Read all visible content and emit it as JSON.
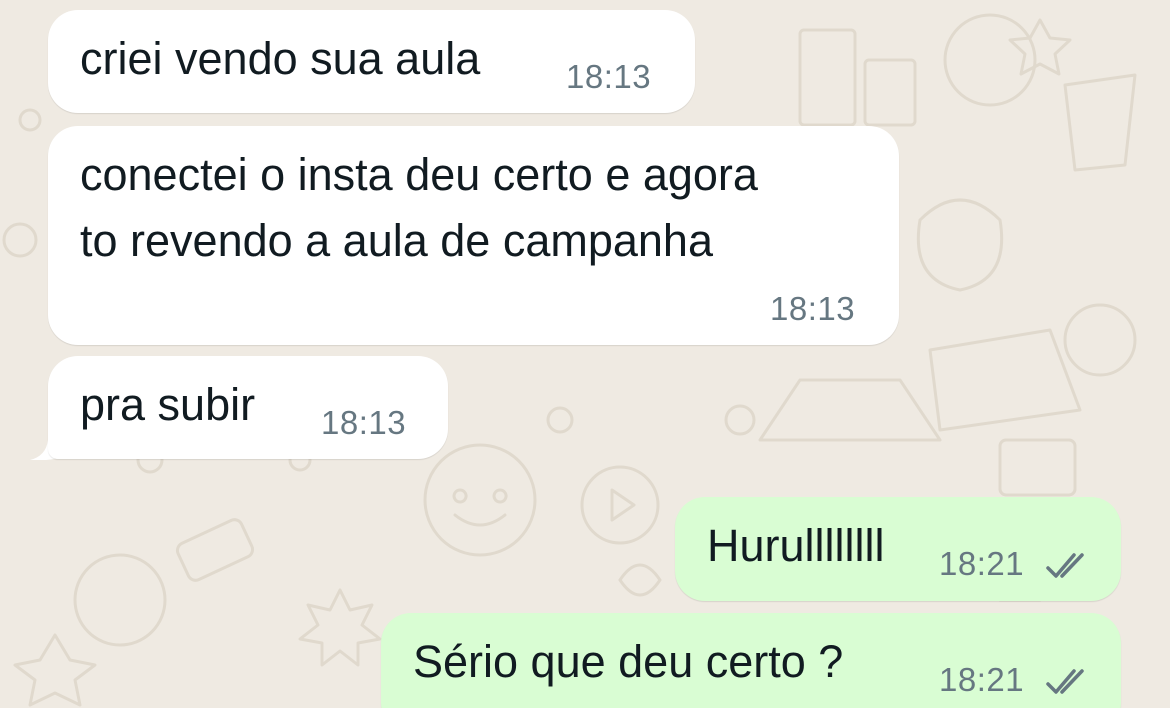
{
  "chat": {
    "messages": [
      {
        "direction": "incoming",
        "lines": [
          "criei vendo sua aula"
        ],
        "time": "18:13"
      },
      {
        "direction": "incoming",
        "lines": [
          "conectei o insta deu certo e agora",
          "to revendo a aula de campanha"
        ],
        "time": "18:13"
      },
      {
        "direction": "incoming",
        "lines": [
          "pra subir"
        ],
        "time": "18:13"
      },
      {
        "direction": "outgoing",
        "lines": [
          "Hurullllllll"
        ],
        "time": "18:21",
        "status": "read",
        "status_icon": "double-check-icon"
      },
      {
        "direction": "outgoing",
        "lines": [
          "Sério que deu certo ?"
        ],
        "time": "18:21",
        "status": "read",
        "status_icon": "double-check-icon"
      }
    ]
  },
  "theme": {
    "wallpaper": "#efeae2",
    "incoming_bubble": "#ffffff",
    "outgoing_bubble": "#d9fdd3",
    "text": "#111b21",
    "meta": "#667781"
  }
}
